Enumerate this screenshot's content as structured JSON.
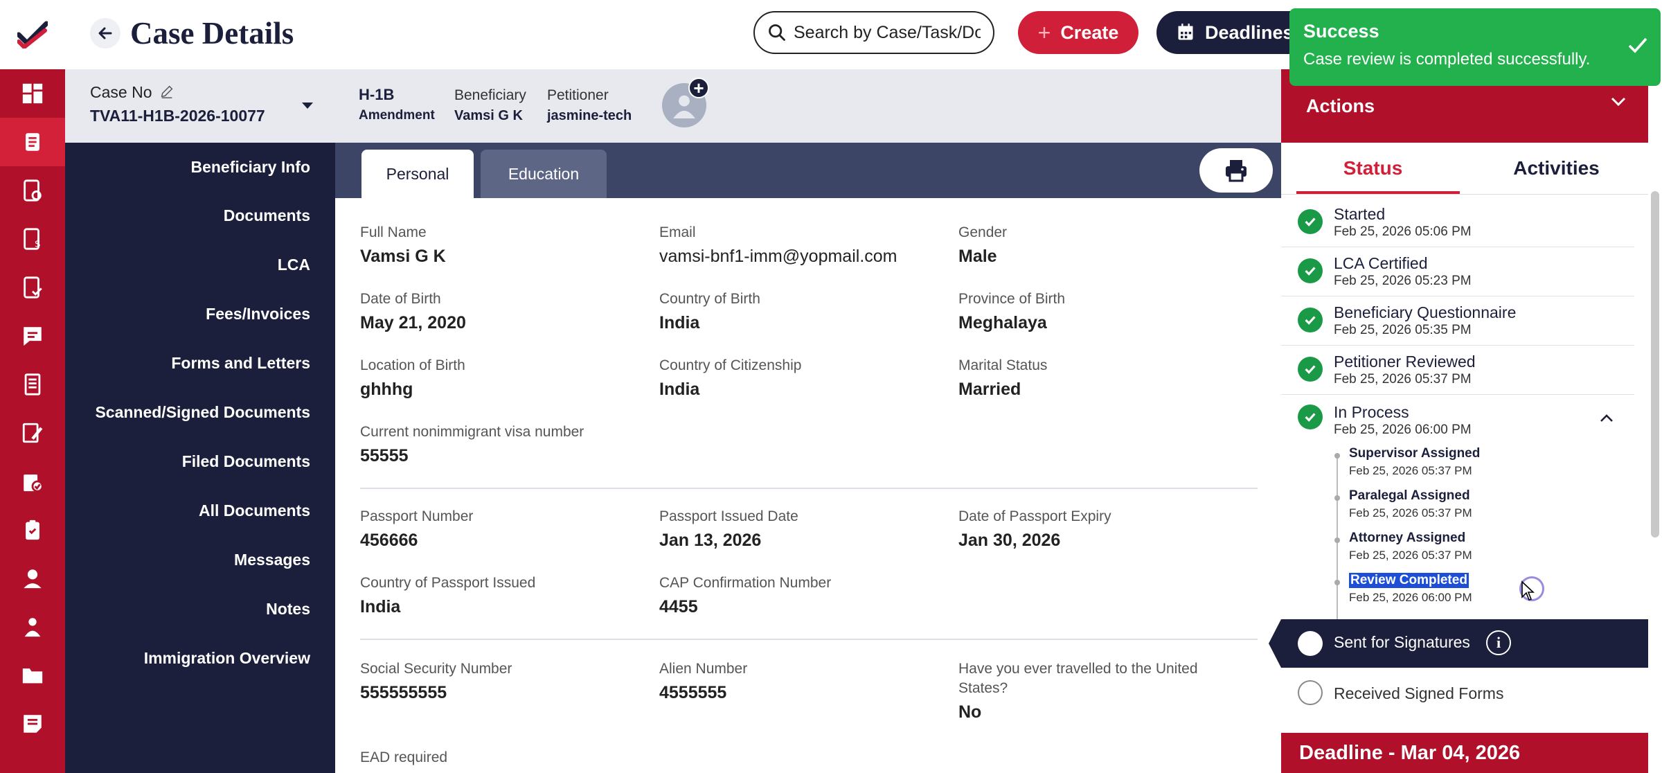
{
  "header": {
    "title": "Case Details",
    "search_placeholder": "Search by Case/Task/Document",
    "create_label": "Create",
    "deadlines_label": "Deadlines"
  },
  "toast": {
    "title": "Success",
    "message": "Case review is completed successfully."
  },
  "case": {
    "case_no_label": "Case No",
    "case_no": "TVA11-H1B-2026-10077",
    "visa_type": "H-1B",
    "visa_subtype": "Amendment",
    "beneficiary_label": "Beneficiary",
    "beneficiary": "Vamsi G K",
    "petitioner_label": "Petitioner",
    "petitioner": "jasmine-tech"
  },
  "sidenav": {
    "items": [
      "Beneficiary Info",
      "Documents",
      "LCA",
      "Fees/Invoices",
      "Forms and Letters",
      "Scanned/Signed Documents",
      "Filed Documents",
      "All Documents",
      "Messages",
      "Notes",
      "Immigration Overview"
    ]
  },
  "tabs": {
    "personal": "Personal",
    "education": "Education"
  },
  "fields": {
    "full_name": {
      "label": "Full Name",
      "value": "Vamsi G K"
    },
    "email": {
      "label": "Email",
      "value": "vamsi-bnf1-imm@yopmail.com"
    },
    "gender": {
      "label": "Gender",
      "value": "Male"
    },
    "dob": {
      "label": "Date of Birth",
      "value": "May 21, 2020"
    },
    "country_birth": {
      "label": "Country of Birth",
      "value": "India"
    },
    "province_birth": {
      "label": "Province of Birth",
      "value": "Meghalaya"
    },
    "location_birth": {
      "label": "Location of Birth",
      "value": "ghhhg"
    },
    "citizenship": {
      "label": "Country of Citizenship",
      "value": "India"
    },
    "marital": {
      "label": "Marital Status",
      "value": "Married"
    },
    "visa_number": {
      "label": "Current nonimmigrant visa number",
      "value": "55555"
    },
    "passport_no": {
      "label": "Passport Number",
      "value": "456666"
    },
    "passport_issued": {
      "label": "Passport Issued Date",
      "value": "Jan 13, 2026"
    },
    "passport_expiry": {
      "label": "Date of Passport Expiry",
      "value": "Jan 30, 2026"
    },
    "passport_country": {
      "label": "Country of Passport Issued",
      "value": "India"
    },
    "cap": {
      "label": "CAP Confirmation Number",
      "value": "4455"
    },
    "ssn": {
      "label": "Social Security Number",
      "value": "555555555"
    },
    "alien": {
      "label": "Alien Number",
      "value": "4555555"
    },
    "travelled_line1": "Have you ever travelled to the United",
    "travelled_line2": "States?",
    "travelled_value": "No",
    "ead_label": "EAD required"
  },
  "panel": {
    "actions_title": "Actions",
    "tab_status": "Status",
    "tab_activities": "Activities",
    "steps": [
      {
        "name": "Started",
        "date": "Feb 25, 2026 05:06 PM"
      },
      {
        "name": "LCA Certified",
        "date": "Feb 25, 2026 05:23 PM"
      },
      {
        "name": "Beneficiary Questionnaire",
        "date": "Feb 25, 2026 05:35 PM"
      },
      {
        "name": "Petitioner Reviewed",
        "date": "Feb 25, 2026 05:37 PM"
      },
      {
        "name": "In Process",
        "date": "Feb 25, 2026 06:00 PM"
      }
    ],
    "substeps": [
      {
        "name": "Supervisor Assigned",
        "date": "Feb 25, 2026 05:37 PM"
      },
      {
        "name": "Paralegal Assigned",
        "date": "Feb 25, 2026 05:37 PM"
      },
      {
        "name": "Attorney Assigned",
        "date": "Feb 25, 2026 05:37 PM"
      },
      {
        "name": "Review Completed",
        "date": "Feb 25, 2026 06:00 PM"
      }
    ],
    "sent_for_signatures": "Sent for Signatures",
    "received_signed_forms": "Received Signed Forms",
    "deadline": "Deadline - Mar 04, 2026"
  },
  "colors": {
    "brand_red": "#b0102a",
    "navy": "#1b1f3b",
    "success_green": "#22b14c",
    "check_green": "#1a9a46"
  },
  "icons": {
    "rail": [
      "dashboard-icon",
      "cases-icon",
      "tasks-icon",
      "invoices-icon",
      "approvals-icon",
      "messages-icon",
      "reports-icon",
      "forms-icon",
      "documents-icon",
      "clipboard-icon",
      "user-icon",
      "team-icon",
      "folder-icon",
      "notes-icon"
    ]
  }
}
